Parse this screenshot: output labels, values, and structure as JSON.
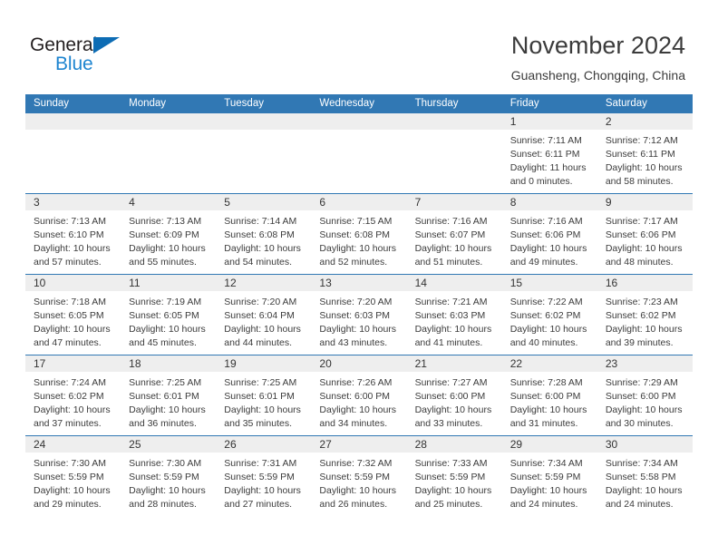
{
  "brand": {
    "name_part1": "General",
    "name_part2": "Blue",
    "accent_color": "#1e85d0",
    "triangle_color": "#0d6cb4"
  },
  "header": {
    "title": "November 2024",
    "location": "Guansheng, Chongqing, China"
  },
  "theme": {
    "header_blue": "#3178b4",
    "daynum_band": "#eeeeee",
    "text": "#3b3b3b"
  },
  "weekdays": [
    "Sunday",
    "Monday",
    "Tuesday",
    "Wednesday",
    "Thursday",
    "Friday",
    "Saturday"
  ],
  "weeks": [
    [
      {
        "day": "",
        "empty": true,
        "sunrise": "",
        "sunset": "",
        "daylight1": "",
        "daylight2": ""
      },
      {
        "day": "",
        "empty": true,
        "sunrise": "",
        "sunset": "",
        "daylight1": "",
        "daylight2": ""
      },
      {
        "day": "",
        "empty": true,
        "sunrise": "",
        "sunset": "",
        "daylight1": "",
        "daylight2": ""
      },
      {
        "day": "",
        "empty": true,
        "sunrise": "",
        "sunset": "",
        "daylight1": "",
        "daylight2": ""
      },
      {
        "day": "",
        "empty": true,
        "sunrise": "",
        "sunset": "",
        "daylight1": "",
        "daylight2": ""
      },
      {
        "day": "1",
        "sunrise": "Sunrise: 7:11 AM",
        "sunset": "Sunset: 6:11 PM",
        "daylight1": "Daylight: 11 hours",
        "daylight2": "and 0 minutes."
      },
      {
        "day": "2",
        "sunrise": "Sunrise: 7:12 AM",
        "sunset": "Sunset: 6:11 PM",
        "daylight1": "Daylight: 10 hours",
        "daylight2": "and 58 minutes."
      }
    ],
    [
      {
        "day": "3",
        "sunrise": "Sunrise: 7:13 AM",
        "sunset": "Sunset: 6:10 PM",
        "daylight1": "Daylight: 10 hours",
        "daylight2": "and 57 minutes."
      },
      {
        "day": "4",
        "sunrise": "Sunrise: 7:13 AM",
        "sunset": "Sunset: 6:09 PM",
        "daylight1": "Daylight: 10 hours",
        "daylight2": "and 55 minutes."
      },
      {
        "day": "5",
        "sunrise": "Sunrise: 7:14 AM",
        "sunset": "Sunset: 6:08 PM",
        "daylight1": "Daylight: 10 hours",
        "daylight2": "and 54 minutes."
      },
      {
        "day": "6",
        "sunrise": "Sunrise: 7:15 AM",
        "sunset": "Sunset: 6:08 PM",
        "daylight1": "Daylight: 10 hours",
        "daylight2": "and 52 minutes."
      },
      {
        "day": "7",
        "sunrise": "Sunrise: 7:16 AM",
        "sunset": "Sunset: 6:07 PM",
        "daylight1": "Daylight: 10 hours",
        "daylight2": "and 51 minutes."
      },
      {
        "day": "8",
        "sunrise": "Sunrise: 7:16 AM",
        "sunset": "Sunset: 6:06 PM",
        "daylight1": "Daylight: 10 hours",
        "daylight2": "and 49 minutes."
      },
      {
        "day": "9",
        "sunrise": "Sunrise: 7:17 AM",
        "sunset": "Sunset: 6:06 PM",
        "daylight1": "Daylight: 10 hours",
        "daylight2": "and 48 minutes."
      }
    ],
    [
      {
        "day": "10",
        "sunrise": "Sunrise: 7:18 AM",
        "sunset": "Sunset: 6:05 PM",
        "daylight1": "Daylight: 10 hours",
        "daylight2": "and 47 minutes."
      },
      {
        "day": "11",
        "sunrise": "Sunrise: 7:19 AM",
        "sunset": "Sunset: 6:05 PM",
        "daylight1": "Daylight: 10 hours",
        "daylight2": "and 45 minutes."
      },
      {
        "day": "12",
        "sunrise": "Sunrise: 7:20 AM",
        "sunset": "Sunset: 6:04 PM",
        "daylight1": "Daylight: 10 hours",
        "daylight2": "and 44 minutes."
      },
      {
        "day": "13",
        "sunrise": "Sunrise: 7:20 AM",
        "sunset": "Sunset: 6:03 PM",
        "daylight1": "Daylight: 10 hours",
        "daylight2": "and 43 minutes."
      },
      {
        "day": "14",
        "sunrise": "Sunrise: 7:21 AM",
        "sunset": "Sunset: 6:03 PM",
        "daylight1": "Daylight: 10 hours",
        "daylight2": "and 41 minutes."
      },
      {
        "day": "15",
        "sunrise": "Sunrise: 7:22 AM",
        "sunset": "Sunset: 6:02 PM",
        "daylight1": "Daylight: 10 hours",
        "daylight2": "and 40 minutes."
      },
      {
        "day": "16",
        "sunrise": "Sunrise: 7:23 AM",
        "sunset": "Sunset: 6:02 PM",
        "daylight1": "Daylight: 10 hours",
        "daylight2": "and 39 minutes."
      }
    ],
    [
      {
        "day": "17",
        "sunrise": "Sunrise: 7:24 AM",
        "sunset": "Sunset: 6:02 PM",
        "daylight1": "Daylight: 10 hours",
        "daylight2": "and 37 minutes."
      },
      {
        "day": "18",
        "sunrise": "Sunrise: 7:25 AM",
        "sunset": "Sunset: 6:01 PM",
        "daylight1": "Daylight: 10 hours",
        "daylight2": "and 36 minutes."
      },
      {
        "day": "19",
        "sunrise": "Sunrise: 7:25 AM",
        "sunset": "Sunset: 6:01 PM",
        "daylight1": "Daylight: 10 hours",
        "daylight2": "and 35 minutes."
      },
      {
        "day": "20",
        "sunrise": "Sunrise: 7:26 AM",
        "sunset": "Sunset: 6:00 PM",
        "daylight1": "Daylight: 10 hours",
        "daylight2": "and 34 minutes."
      },
      {
        "day": "21",
        "sunrise": "Sunrise: 7:27 AM",
        "sunset": "Sunset: 6:00 PM",
        "daylight1": "Daylight: 10 hours",
        "daylight2": "and 33 minutes."
      },
      {
        "day": "22",
        "sunrise": "Sunrise: 7:28 AM",
        "sunset": "Sunset: 6:00 PM",
        "daylight1": "Daylight: 10 hours",
        "daylight2": "and 31 minutes."
      },
      {
        "day": "23",
        "sunrise": "Sunrise: 7:29 AM",
        "sunset": "Sunset: 6:00 PM",
        "daylight1": "Daylight: 10 hours",
        "daylight2": "and 30 minutes."
      }
    ],
    [
      {
        "day": "24",
        "sunrise": "Sunrise: 7:30 AM",
        "sunset": "Sunset: 5:59 PM",
        "daylight1": "Daylight: 10 hours",
        "daylight2": "and 29 minutes."
      },
      {
        "day": "25",
        "sunrise": "Sunrise: 7:30 AM",
        "sunset": "Sunset: 5:59 PM",
        "daylight1": "Daylight: 10 hours",
        "daylight2": "and 28 minutes."
      },
      {
        "day": "26",
        "sunrise": "Sunrise: 7:31 AM",
        "sunset": "Sunset: 5:59 PM",
        "daylight1": "Daylight: 10 hours",
        "daylight2": "and 27 minutes."
      },
      {
        "day": "27",
        "sunrise": "Sunrise: 7:32 AM",
        "sunset": "Sunset: 5:59 PM",
        "daylight1": "Daylight: 10 hours",
        "daylight2": "and 26 minutes."
      },
      {
        "day": "28",
        "sunrise": "Sunrise: 7:33 AM",
        "sunset": "Sunset: 5:59 PM",
        "daylight1": "Daylight: 10 hours",
        "daylight2": "and 25 minutes."
      },
      {
        "day": "29",
        "sunrise": "Sunrise: 7:34 AM",
        "sunset": "Sunset: 5:59 PM",
        "daylight1": "Daylight: 10 hours",
        "daylight2": "and 24 minutes."
      },
      {
        "day": "30",
        "sunrise": "Sunrise: 7:34 AM",
        "sunset": "Sunset: 5:58 PM",
        "daylight1": "Daylight: 10 hours",
        "daylight2": "and 24 minutes."
      }
    ]
  ]
}
